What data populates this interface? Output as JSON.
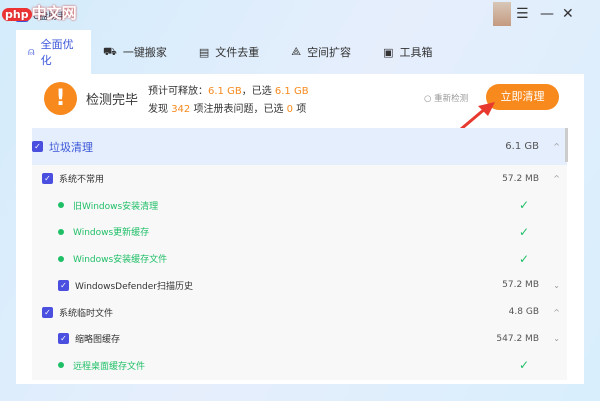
{
  "app": {
    "title": "C盘助手",
    "watermark": "php中文网"
  },
  "tabs": [
    {
      "label": "全面优化",
      "icon": "rocket-icon"
    },
    {
      "label": "一键搬家",
      "icon": "truck-icon"
    },
    {
      "label": "文件去重",
      "icon": "file-icon"
    },
    {
      "label": "空间扩容",
      "icon": "expand-icon"
    },
    {
      "label": "工具箱",
      "icon": "toolbox-icon"
    }
  ],
  "summary": {
    "status": "检测完毕",
    "line1_prefix": "预计可释放：",
    "release": "6.1 GB",
    "line1_mid": "，已选",
    "selected_size": "6.1 GB",
    "line2_prefix": "发现",
    "issues": "342",
    "line2_mid": "项注册表问题，已选",
    "selected_issues": "0",
    "line2_suffix": "项",
    "rescan": "重新检测",
    "clean_button": "立即清理"
  },
  "list": {
    "root": {
      "label": "垃圾清理",
      "size": "6.1 GB"
    },
    "rows": [
      {
        "type": "group",
        "label": "系统不常用",
        "size": "57.2 MB",
        "chev": "^"
      },
      {
        "type": "done",
        "label": "旧Windows安装清理"
      },
      {
        "type": "done",
        "label": "Windows更新缓存"
      },
      {
        "type": "done",
        "label": "Windows安装缓存文件"
      },
      {
        "type": "item",
        "label": "WindowsDefender扫描历史",
        "size": "57.2 MB",
        "chev": "v"
      },
      {
        "type": "group",
        "label": "系统临时文件",
        "size": "4.8 GB",
        "chev": "^"
      },
      {
        "type": "item",
        "label": "缩略图缓存",
        "size": "547.2 MB",
        "chev": "v"
      },
      {
        "type": "done",
        "label": "远程桌面缓存文件"
      }
    ]
  },
  "colors": {
    "accent": "#f7891d",
    "primary": "#4a4fe0",
    "success": "#1fbf67"
  }
}
